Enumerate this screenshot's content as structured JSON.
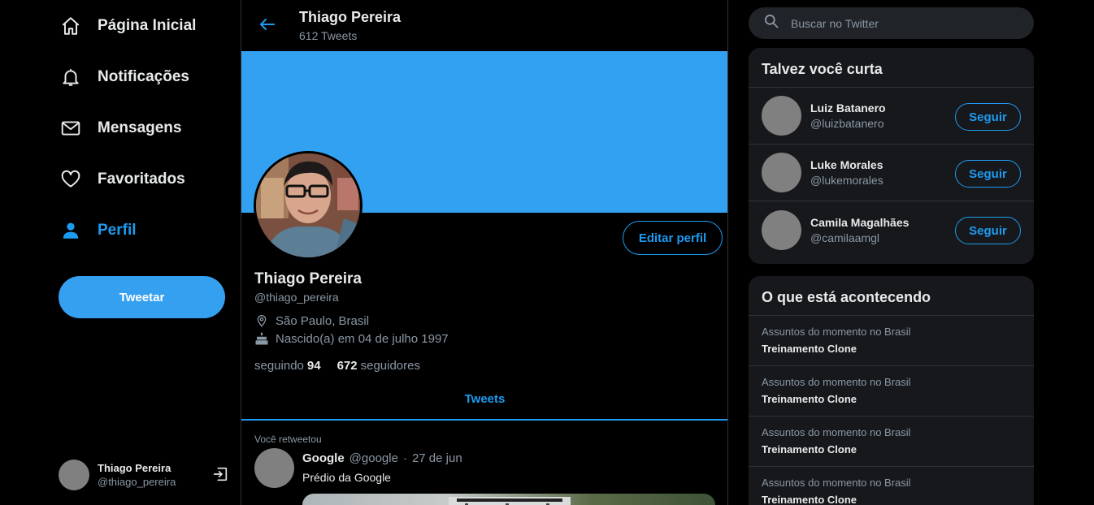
{
  "nav": {
    "items": [
      {
        "label": "Página Inicial",
        "icon": "home-icon"
      },
      {
        "label": "Notificações",
        "icon": "bell-icon"
      },
      {
        "label": "Mensagens",
        "icon": "mail-icon"
      },
      {
        "label": "Favoritados",
        "icon": "heart-icon"
      },
      {
        "label": "Perfil",
        "icon": "person-icon",
        "active": true
      }
    ],
    "tweet_button": "Tweetar",
    "account": {
      "name": "Thiago Pereira",
      "handle": "@thiago_pereira"
    }
  },
  "header": {
    "title": "Thiago Pereira",
    "subtitle": "612 Tweets"
  },
  "profile": {
    "edit_button": "Editar perfil",
    "name": "Thiago Pereira",
    "handle": "@thiago_pereira",
    "location": "São Paulo, Brasil",
    "birth": "Nascido(a) em 04 de julho 1997",
    "following_label": "seguindo",
    "following_count": "94",
    "followers_count": "672",
    "followers_label": "seguidores"
  },
  "tabs": {
    "tweets": "Tweets"
  },
  "tweet": {
    "retweet_label": "Você retweetou",
    "author": "Google",
    "handle": "@google",
    "dot": "·",
    "date": "27 de jun",
    "text": "Prédio da Google"
  },
  "search": {
    "placeholder": "Buscar no Twitter"
  },
  "who_to_follow": {
    "title": "Talvez você curta",
    "users": [
      {
        "name": "Luiz Batanero",
        "handle": "@luizbatanero",
        "button": "Seguir"
      },
      {
        "name": "Luke Morales",
        "handle": "@lukemorales",
        "button": "Seguir"
      },
      {
        "name": "Camila Magalhães",
        "handle": "@camilaamgl",
        "button": "Seguir"
      }
    ]
  },
  "trends": {
    "title": "O que está acontecendo",
    "items": [
      {
        "context": "Assuntos do momento no Brasil",
        "topic": "Treinamento Clone"
      },
      {
        "context": "Assuntos do momento no Brasil",
        "topic": "Treinamento Clone"
      },
      {
        "context": "Assuntos do momento no Brasil",
        "topic": "Treinamento Clone"
      },
      {
        "context": "Assuntos do momento no Brasil",
        "topic": "Treinamento Clone"
      }
    ]
  },
  "colors": {
    "accent": "#1d9bf0",
    "banner": "#33a1f2",
    "panel": "#16181c",
    "background": "#000000"
  }
}
